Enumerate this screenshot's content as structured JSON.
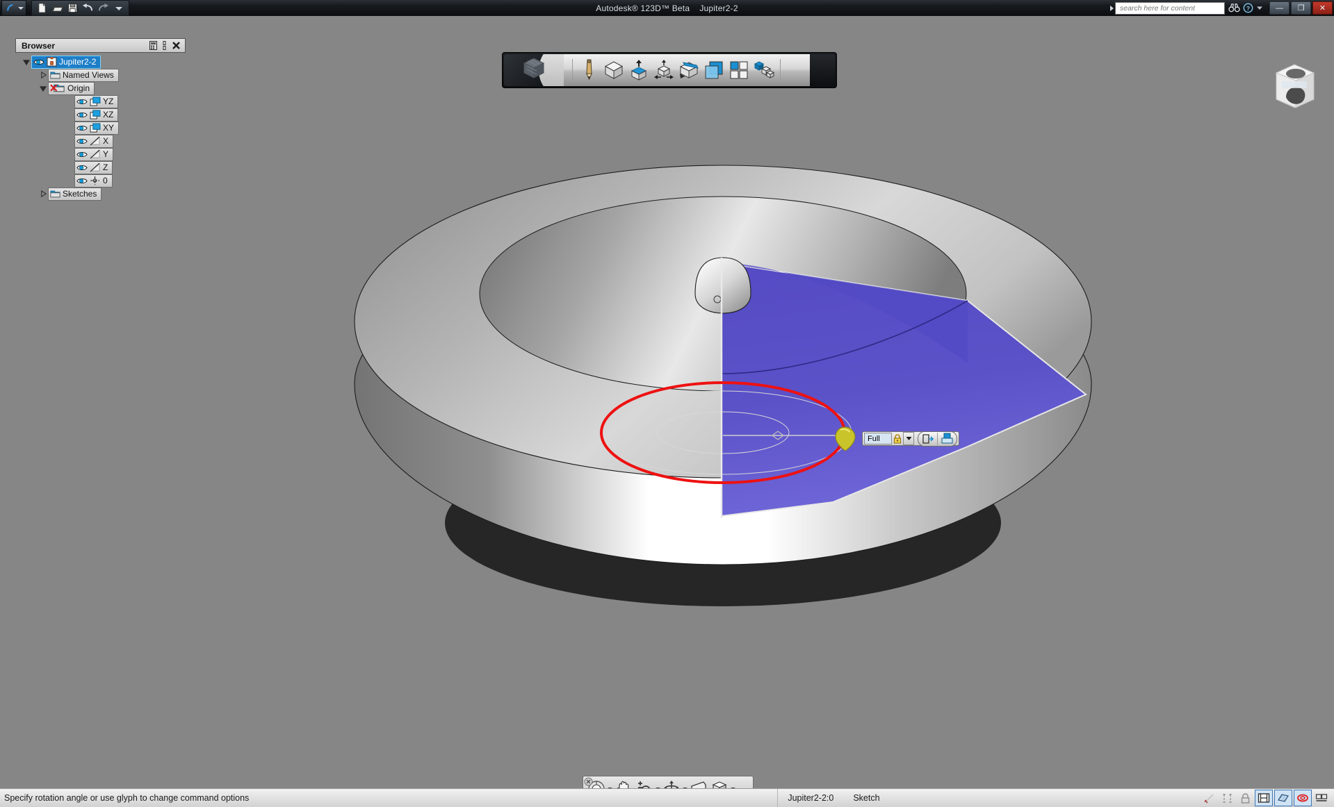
{
  "titlebar": {
    "app_title": "Autodesk® 123D™ Beta",
    "document_title": "Jupiter2-2",
    "quick_access": [
      {
        "name": "new-file",
        "label": "New"
      },
      {
        "name": "open-file",
        "label": "Open"
      },
      {
        "name": "save-file",
        "label": "Save"
      },
      {
        "name": "undo",
        "label": "Undo"
      },
      {
        "name": "redo",
        "label": "Redo"
      },
      {
        "name": "customize-qat",
        "label": "Customize Quick Access Toolbar"
      }
    ],
    "search": {
      "placeholder": "search here for content",
      "value": ""
    },
    "binoculars_label": "Search",
    "help_label": "?",
    "window_buttons": {
      "minimize": "—",
      "maximize": "❐",
      "close": "✕"
    }
  },
  "browser": {
    "title": "Browser",
    "panel_buttons": [
      {
        "name": "panel-dock",
        "label": "Dock"
      },
      {
        "name": "panel-pin",
        "label": "Auto-hide"
      },
      {
        "name": "panel-close",
        "label": "Close"
      }
    ],
    "tree": [
      {
        "label": "Jupiter2-2",
        "level": 0,
        "expander": "down",
        "selected": true,
        "icon": "eye-part-icon",
        "type": "part"
      },
      {
        "label": "Named Views",
        "level": 1,
        "expander": "right",
        "selected": false,
        "icon": "folder-icon",
        "type": "folder"
      },
      {
        "label": "Origin",
        "level": 1,
        "expander": "down",
        "selected": false,
        "icon": "folder-hidden-icon",
        "type": "folder-hidden"
      },
      {
        "label": "YZ",
        "level": 2,
        "expander": "none",
        "selected": false,
        "icon": "eye-plane-icon",
        "type": "plane"
      },
      {
        "label": "XZ",
        "level": 2,
        "expander": "none",
        "selected": false,
        "icon": "eye-plane-icon",
        "type": "plane"
      },
      {
        "label": "XY",
        "level": 2,
        "expander": "none",
        "selected": false,
        "icon": "eye-plane-icon",
        "type": "plane"
      },
      {
        "label": "X",
        "level": 2,
        "expander": "none",
        "selected": false,
        "icon": "eye-axis-icon",
        "type": "axis"
      },
      {
        "label": "Y",
        "level": 2,
        "expander": "none",
        "selected": false,
        "icon": "eye-axis-icon",
        "type": "axis"
      },
      {
        "label": "Z",
        "level": 2,
        "expander": "none",
        "selected": false,
        "icon": "eye-axis-icon",
        "type": "axis"
      },
      {
        "label": "0",
        "level": 2,
        "expander": "none",
        "selected": false,
        "icon": "eye-point-icon",
        "type": "point"
      },
      {
        "label": "Sketches",
        "level": 1,
        "expander": "right",
        "selected": false,
        "icon": "folder-icon",
        "type": "folder"
      }
    ]
  },
  "main_toolbar": {
    "items": [
      {
        "name": "app-cube-logo",
        "label": "123D"
      },
      {
        "name": "sketch-tool",
        "label": "Sketch"
      },
      {
        "name": "primitives-tool",
        "label": "Primitives"
      },
      {
        "name": "construct-tool",
        "label": "Construct"
      },
      {
        "name": "modify-tool",
        "label": "Modify"
      },
      {
        "name": "sketch-edit-tool",
        "label": "Sketch Edit"
      },
      {
        "name": "combine-tool",
        "label": "Combine"
      },
      {
        "name": "pattern-tool",
        "label": "Pattern"
      },
      {
        "name": "assemble-tool",
        "label": "Assemble"
      }
    ]
  },
  "glyph_toolbar": {
    "angle_value": "Full",
    "lock_label": "Lock angle",
    "dropdown_label": "▼",
    "buttons": [
      {
        "name": "flip-direction-button",
        "label": "Flip direction"
      },
      {
        "name": "operation-button",
        "label": "Operation"
      }
    ]
  },
  "navbar": {
    "items": [
      {
        "name": "steering-wheel-button",
        "label": "SteeringWheels",
        "has_arrow": true
      },
      {
        "name": "pan-button",
        "label": "Pan",
        "has_arrow": false
      },
      {
        "name": "zoom-button",
        "label": "Zoom",
        "has_arrow": true
      },
      {
        "name": "orbit-button",
        "label": "Orbit",
        "has_arrow": true
      },
      {
        "name": "look-button",
        "label": "Look",
        "has_arrow": false
      },
      {
        "name": "display-style-button",
        "label": "Display Style",
        "has_arrow": true
      }
    ]
  },
  "statusbar": {
    "message": "Specify rotation angle or use glyph to change command options",
    "document": "Jupiter2-2:0",
    "mode": "Sketch",
    "toggles": [
      {
        "name": "snap-icon",
        "label": "Snap",
        "active": false
      },
      {
        "name": "constraints-icon",
        "label": "Constraints",
        "active": false
      },
      {
        "name": "lock-icon",
        "label": "Lock",
        "active": false
      },
      {
        "name": "grid-icon",
        "label": "Grid Display",
        "active": true
      },
      {
        "name": "shaded-icon",
        "label": "Shaded Display",
        "active": true
      },
      {
        "name": "orbit-mode-icon",
        "label": "Free Orbit",
        "active": true
      },
      {
        "name": "window-icon",
        "label": "Window Layout",
        "active": false
      }
    ]
  },
  "viewport": {
    "viewcube_label": "ViewCube",
    "model_name": "revolve-preview",
    "colors": {
      "selection_purple": "#5b52c8",
      "selection_purple_light": "#6f66d8",
      "axis_red": "#ee1111",
      "glyph_yellow": "#c9c42a",
      "background": "#868686",
      "accent_blue": "#1d7ec8"
    }
  }
}
